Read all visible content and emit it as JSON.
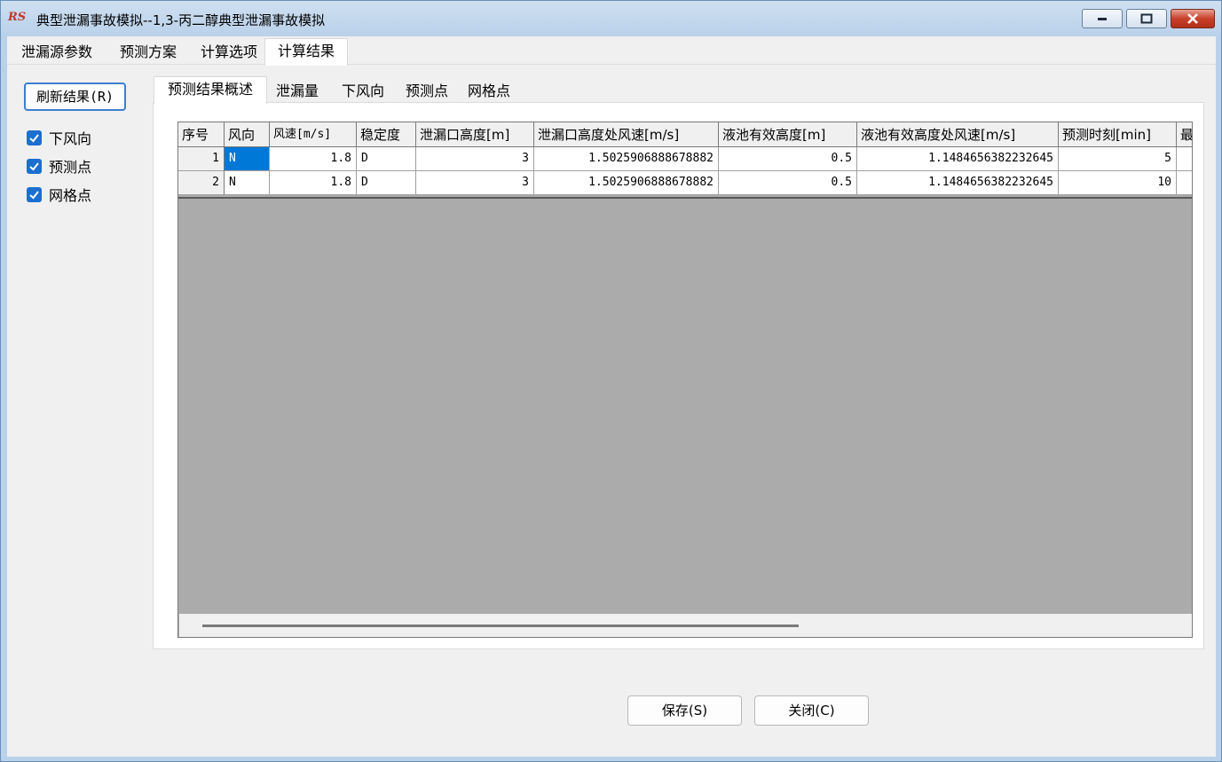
{
  "window": {
    "title": "典型泄漏事故模拟--1,3-丙二醇典型泄漏事故模拟",
    "icon_text": "RS"
  },
  "top_tabs": [
    {
      "label": "泄漏源参数"
    },
    {
      "label": "预测方案"
    },
    {
      "label": "计算选项"
    },
    {
      "label": "计算结果",
      "active": true
    }
  ],
  "sidebar": {
    "refresh_label": "刷新结果(R)",
    "checkboxes": [
      {
        "label": "下风向",
        "checked": true
      },
      {
        "label": "预测点",
        "checked": true
      },
      {
        "label": "网格点",
        "checked": true
      }
    ]
  },
  "inner_tabs": [
    {
      "label": "预测结果概述",
      "active": true
    },
    {
      "label": "泄漏量"
    },
    {
      "label": "下风向"
    },
    {
      "label": "预测点"
    },
    {
      "label": "网格点"
    }
  ],
  "table": {
    "columns": [
      "序号",
      "风向",
      "风速[m/s]",
      "稳定度",
      "泄漏口高度[m]",
      "泄漏口高度处风速[m/s]",
      "液池有效高度[m]",
      "液池有效高度处风速[m/s]",
      "预测时刻[min]",
      "最"
    ],
    "rows": [
      [
        "1",
        "N",
        "1.8",
        "D",
        "3",
        "1.5025906888678882",
        "0.5",
        "1.1484656382232645",
        "5",
        ""
      ],
      [
        "2",
        "N",
        "1.8",
        "D",
        "3",
        "1.5025906888678882",
        "0.5",
        "1.1484656382232645",
        "10",
        ""
      ]
    ]
  },
  "buttons": {
    "save_label": "保存(S)",
    "close_label": "关闭(C)"
  }
}
